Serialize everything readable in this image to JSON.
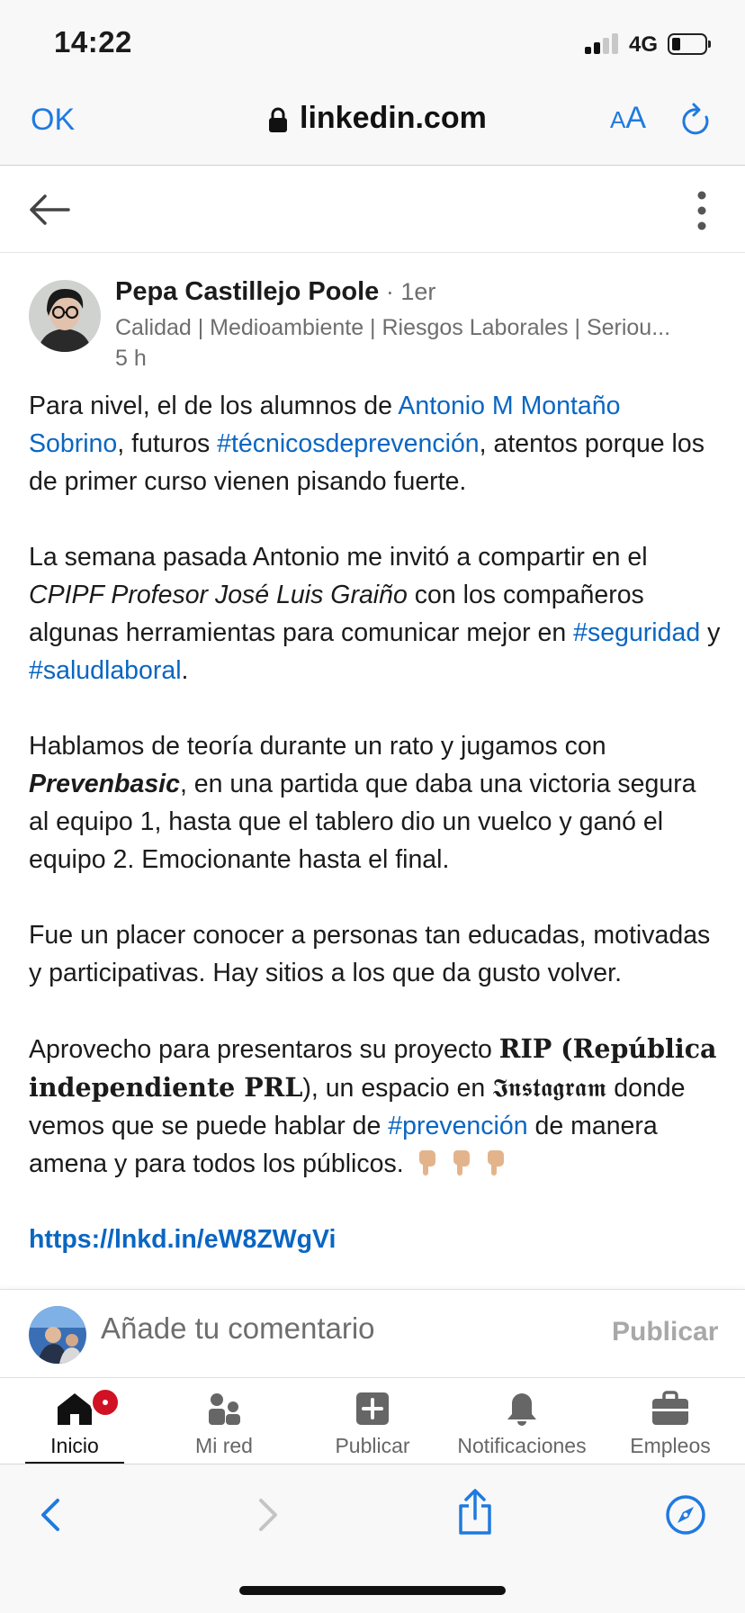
{
  "status": {
    "time": "14:22",
    "network": "4G"
  },
  "browser": {
    "ok_label": "OK",
    "domain": "linkedin.com",
    "aa_small": "A",
    "aa_big": "A"
  },
  "author": {
    "name": "Pepa Castillejo Poole",
    "degree": " · 1er",
    "headline": "Calidad | Medioambiente | Riesgos Laborales | Seriou...",
    "time": "5 h"
  },
  "post": {
    "p1": {
      "t1": "Para nivel, el de los alumnos de ",
      "mention": "Antonio M Montaño Sobrino",
      "t2": ", futuros ",
      "tag": "#técnicosdeprevención",
      "t3": ", atentos porque los de primer curso vienen pisando fuerte."
    },
    "p2": {
      "t1": "La semana pasada Antonio me invitó a compartir en el ",
      "italic": "CPIPF Profesor José Luis Graiño",
      "t2": " con los compañeros algunas herramientas para comunicar mejor en ",
      "tag1": "#seguridad",
      "t3": " y ",
      "tag2": "#saludlaboral",
      "t4": "."
    },
    "p3": {
      "t1": "Hablamos de teoría durante un rato y jugamos con ",
      "bold_italic": "Prevenbasic",
      "t2": ", en una partida que daba una victoria segura al equipo 1, hasta que el tablero dio un vuelco y ganó el equipo 2. Emocionante hasta el final."
    },
    "p4": "Fue un placer conocer a personas tan educadas, motivadas y participativas. Hay sitios a los que da gusto volver.",
    "p5": {
      "t1": "Aprovecho para presentaros su proyecto ",
      "b1": "RIP (República independiente PRL",
      "t2": "), un espacio en ",
      "fraktur": "𝕴𝖓𝖘𝖙𝖆𝖌𝖗𝖆𝖒",
      "t3": " donde vemos que se puede hablar de ",
      "tag": "#prevención",
      "t4": " de manera amena y para todos los públicos."
    },
    "url": "https://lnkd.in/eW8ZWgVi"
  },
  "comment": {
    "placeholder": "Añade tu comentario",
    "publish": "Publicar"
  },
  "nav": {
    "items": [
      {
        "label": "Inicio"
      },
      {
        "label": "Mi red"
      },
      {
        "label": "Publicar"
      },
      {
        "label": "Notificaciones"
      },
      {
        "label": "Empleos"
      }
    ]
  },
  "colors": {
    "link": "#0a66c2",
    "ios_blue": "#1f7ae0",
    "badge": "#d11124"
  }
}
